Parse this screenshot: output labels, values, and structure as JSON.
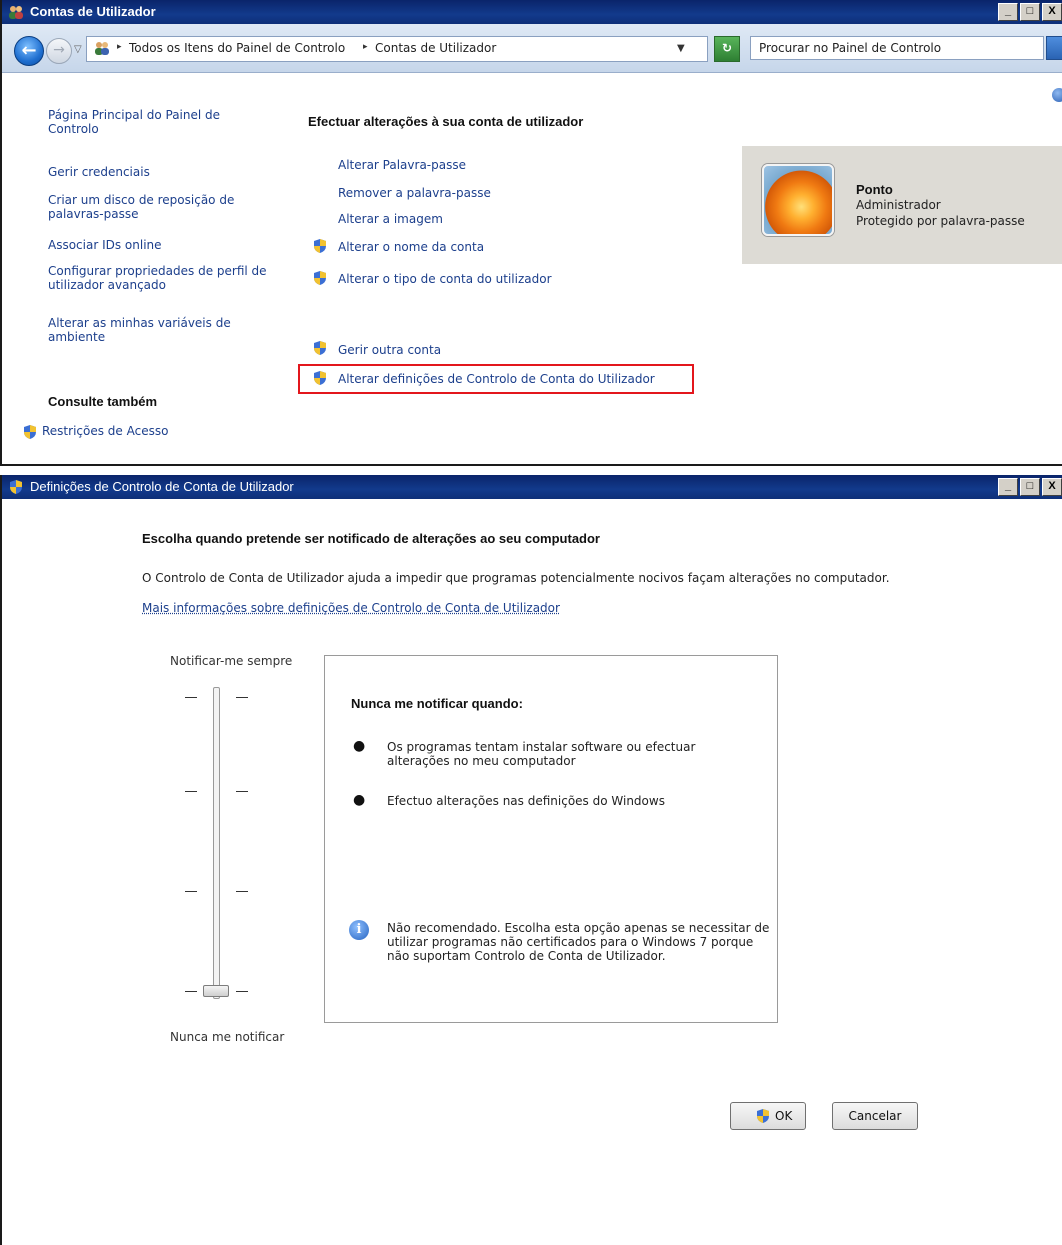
{
  "window1": {
    "title": "Contas de Utilizador",
    "breadcrumb": [
      "Todos os Itens do Painel de Controlo",
      "Contas de Utilizador"
    ],
    "search_placeholder": "Procurar no Painel de Controlo",
    "sidebar_links": [
      "Página Principal do Painel de Controlo",
      "Gerir credenciais",
      "Criar um disco de reposição de palavras-passe",
      "Associar IDs online",
      "Configurar propriedades de perfil de utilizador avançado",
      "Alterar as minhas variáveis de ambiente"
    ],
    "see_also_heading": "Consulte também",
    "see_also_link": "Restrições de Acesso",
    "main_heading": "Efectuar alterações à sua conta de utilizador",
    "tasks": [
      "Alterar Palavra-passe",
      "Remover a palavra-passe",
      "Alterar a imagem",
      "Alterar o nome da conta",
      "Alterar o tipo de conta do utilizador"
    ],
    "other_tasks": [
      "Gerir outra conta",
      "Alterar definições de Controlo de Conta do Utilizador"
    ],
    "user": {
      "name": "Ponto",
      "role": "Administrador",
      "status": "Protegido por palavra-passe"
    },
    "highlight_color": "#e3161c"
  },
  "window2": {
    "title": "Definições de Controlo de Conta de Utilizador",
    "heading": "Escolha quando pretende ser notificado de alterações ao seu computador",
    "description": "O Controlo de Conta de Utilizador ajuda a impedir que programas potencialmente nocivos façam alterações no computador.",
    "more_info_link": "Mais informações sobre definições de Controlo de Conta de Utilizador",
    "slider_top_label": "Notificar-me sempre",
    "slider_bottom_label": "Nunca me notificar",
    "slider_level": 0,
    "slider_levels_total": 4,
    "info_title": "Nunca me notificar quando:",
    "bullets": [
      "Os programas tentam instalar software ou efectuar alterações no meu computador",
      "Efectuo alterações nas definições do Windows"
    ],
    "note": "Não recomendado. Escolha esta opção apenas se necessitar de utilizar programas não certificados para o Windows 7 porque não suportam Controlo de Conta de Utilizador.",
    "ok_label": "OK",
    "cancel_label": "Cancelar"
  },
  "titlebar_buttons": [
    "_",
    "□",
    "X"
  ]
}
